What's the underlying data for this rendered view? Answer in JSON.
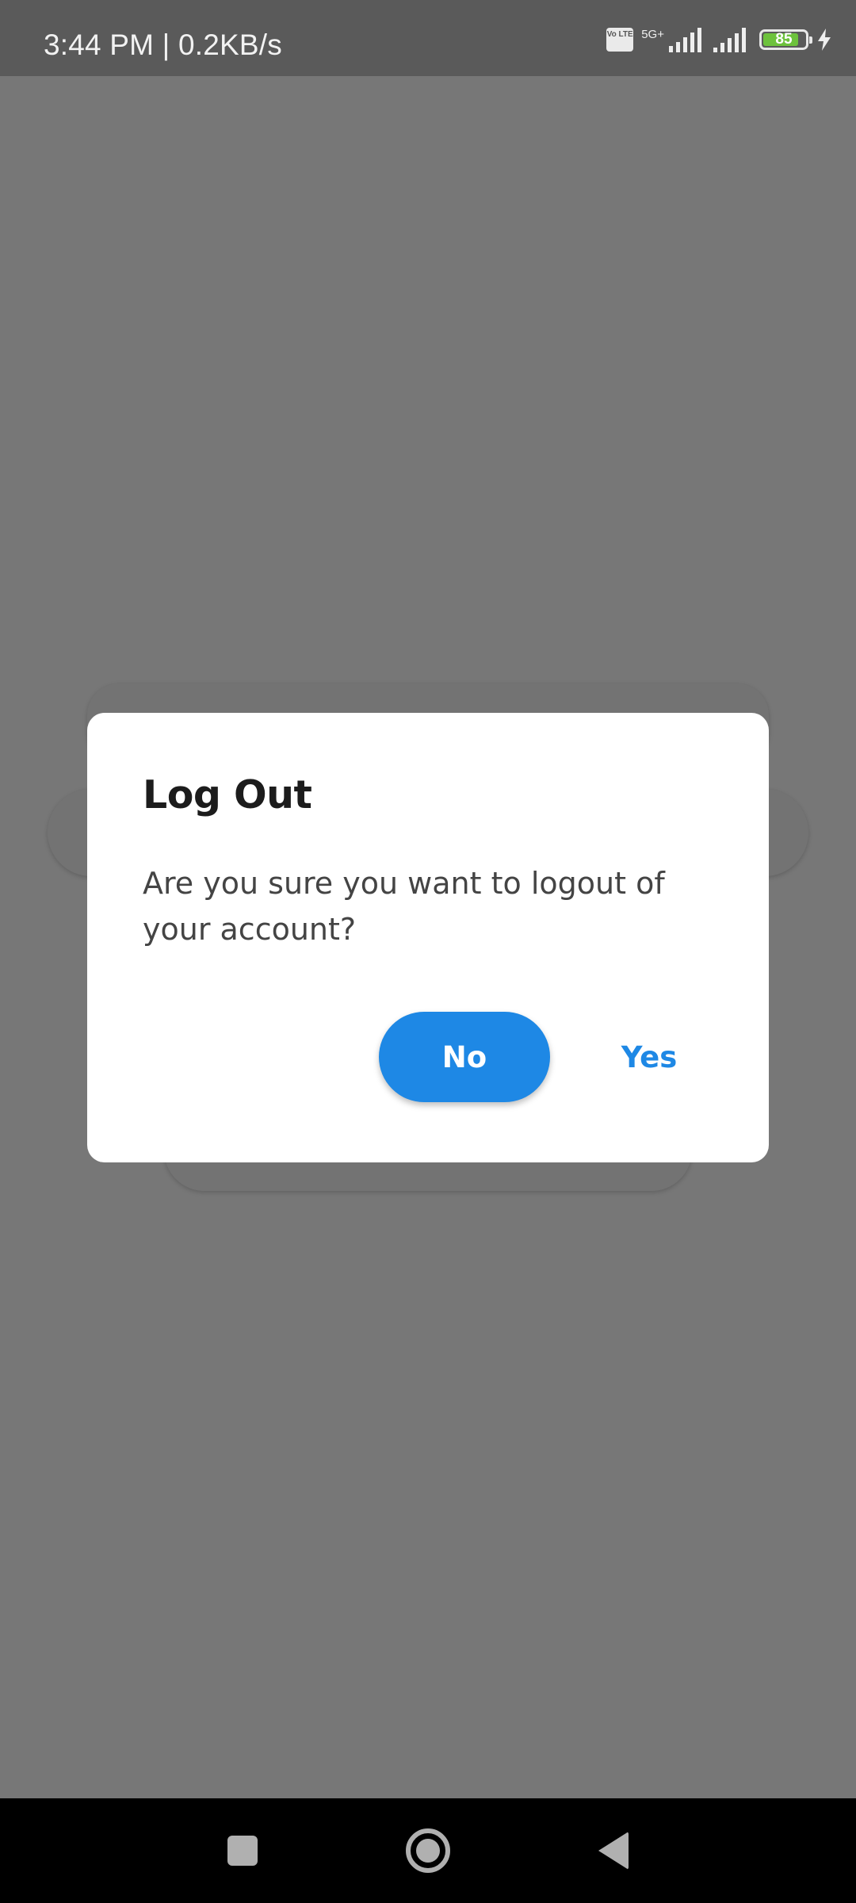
{
  "status_bar": {
    "time_speed": "3:44 PM | 0.2KB/s",
    "volte": "Vo LTE",
    "network_type": "5G+",
    "battery_level": "85",
    "battery_fraction": 0.85
  },
  "dialog": {
    "title": "Log Out",
    "message": "Are you sure you want to logout of your account?",
    "no_label": "No",
    "yes_label": "Yes"
  },
  "colors": {
    "accent": "#1e88e5",
    "overlay": "#777777",
    "battery_fill": "#6dc23c"
  },
  "nav_bar": {
    "icons": [
      "recents-icon",
      "home-icon",
      "back-icon"
    ]
  }
}
